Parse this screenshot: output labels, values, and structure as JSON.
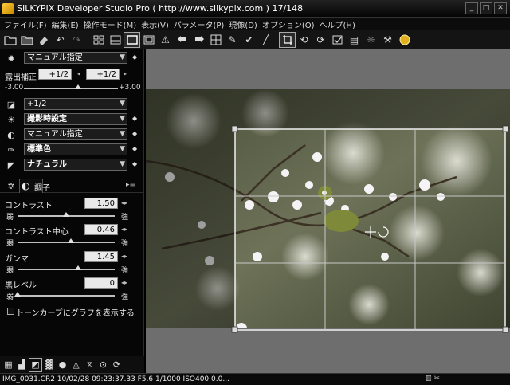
{
  "window": {
    "title": "SILKYPIX Developer Studio Pro ( http://www.silkypix.com )  17/148",
    "controls": [
      "minimize",
      "maximize",
      "close"
    ]
  },
  "menu": {
    "items": [
      "ファイル(F)",
      "編集(E)",
      "操作モード(M)",
      "表示(V)",
      "パラメータ(P)",
      "現像(D)",
      "オプション(O)",
      "ヘルプ(H)"
    ]
  },
  "toolbar": {
    "buttons": [
      "open-folder-icon",
      "save-icon",
      "eraser-icon",
      "undo-icon",
      "redo-icon",
      "thumbnail-view-icon",
      "combined-view-icon",
      "preview-view-icon",
      "full-view-icon",
      "warning-icon",
      "prev-icon",
      "next-icon",
      "grid-icon",
      "select-icon",
      "mark-icon",
      "brush-icon",
      "crop-icon",
      "rotate-left-icon",
      "rotate-right-icon",
      "check-icon",
      "print-icon",
      "develop-icon",
      "hammer-icon",
      "coin-icon"
    ]
  },
  "panel": {
    "preset": {
      "value": "マニュアル指定"
    },
    "exposure": {
      "label": "露出補正",
      "value_left": "+1/2",
      "value_right": "+1/2",
      "min": "-3.00",
      "max": "+3.00",
      "level": 0.58
    },
    "white_balance": {
      "value": "+1/2"
    },
    "lighting": {
      "value": "撮影時設定"
    },
    "tone": {
      "value": "マニュアル指定"
    },
    "color": {
      "value": "標準色"
    },
    "style": {
      "value": "ナチュラル"
    },
    "section_title": "調子",
    "contrast": {
      "label": "コントラスト",
      "value": "1.50",
      "low": "弱",
      "high": "強",
      "level": 0.5
    },
    "contrast_center": {
      "label": "コントラスト中心",
      "value": "0.46",
      "low": "弱",
      "high": "強",
      "level": 0.55
    },
    "gamma": {
      "label": "ガンマ",
      "value": "1.45",
      "low": "弱",
      "high": "強",
      "level": 0.62
    },
    "black_level": {
      "label": "黒レベル",
      "value": "0",
      "low": "弱",
      "high": "強",
      "level": 0.0
    },
    "tone_curve_checkbox": "トーンカーブにグラフを表示する"
  },
  "status": {
    "text": "IMG_0031.CR2 10/02/28 09:23:37.33  F5.6 1/1000 ISO400  0.0..."
  }
}
